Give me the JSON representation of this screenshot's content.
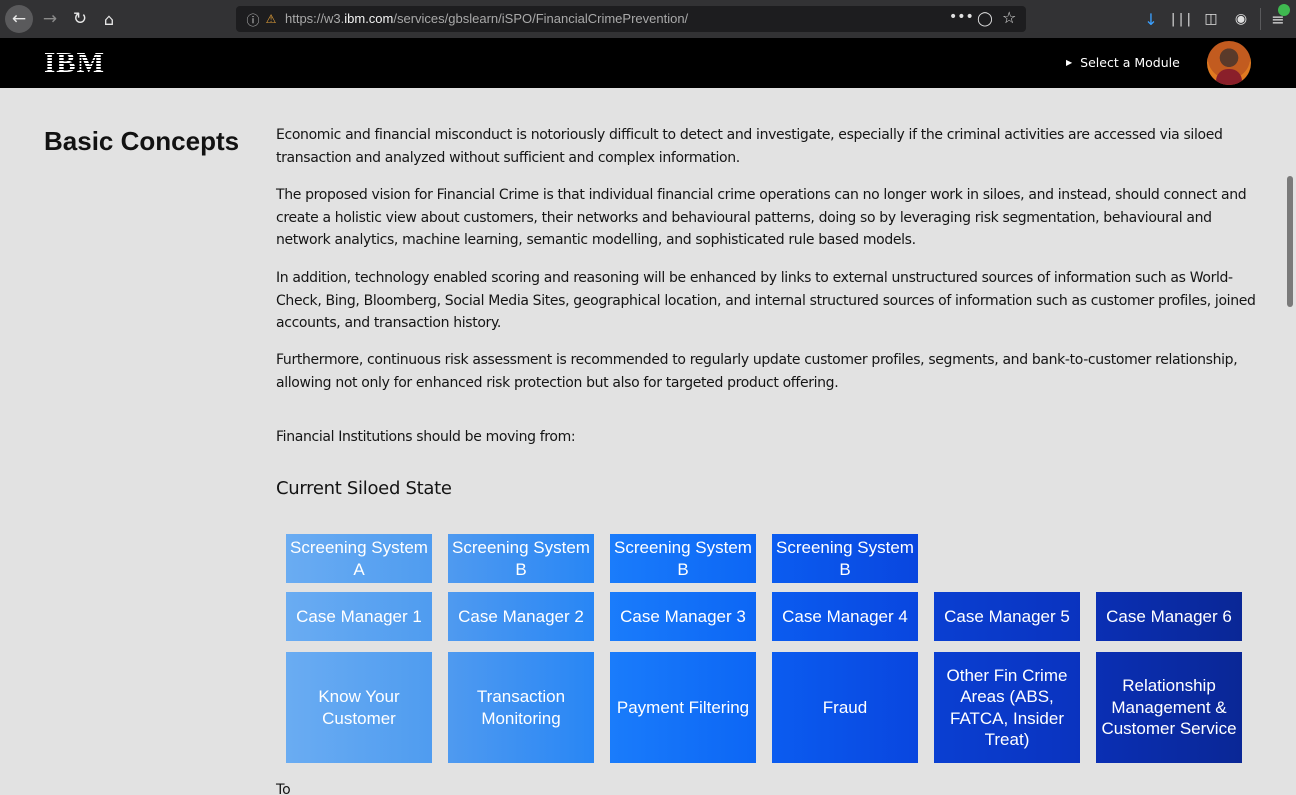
{
  "browser": {
    "url_prefix": "https://w3.",
    "url_domain": "ibm.com",
    "url_path": "/services/gbslearn/iSPO/FinancialCrimePrevention/",
    "icons": {
      "back": "arrow-left-icon",
      "forward": "arrow-right-icon",
      "reload": "reload-icon",
      "home": "home-icon",
      "info": "info-icon",
      "lock": "lock-warning-icon",
      "more": "more-icon",
      "pocket": "pocket-icon",
      "bookmark": "star-icon",
      "download": "download-icon",
      "library": "library-icon",
      "sidebar": "sidebar-icon",
      "account": "account-icon",
      "menu": "hamburger-menu-icon"
    }
  },
  "header": {
    "logo": "IBM",
    "module_link": "Select a Module"
  },
  "content": {
    "section_title": "Basic Concepts",
    "paragraphs": [
      "Economic and financial misconduct is notoriously difficult to detect and investigate, especially if the criminal activities are accessed via siloed transaction and analyzed without sufficient and complex information.",
      "The proposed vision for Financial Crime is that individual financial crime operations can no longer work in siloes, and instead, should connect and create a holistic view about customers, their networks and behavioural patterns, doing so by leveraging risk segmentation, behavioural and network analytics, machine learning, semantic modelling, and sophisticated rule based models.",
      "In addition, technology enabled scoring and reasoning will be enhanced by links to external unstructured sources of information such as World-Check, Bing, Bloomberg, Social Media Sites, geographical location, and internal structured sources of information such as customer profiles, joined accounts, and transaction history.",
      "Furthermore, continuous risk assessment is recommended to regularly update customer profiles, segments, and bank-to-customer relationship, allowing not only for enhanced risk protection but also for targeted product offering.",
      "Financial Institutions should be moving from:"
    ],
    "state_title": "Current Siloed State",
    "to_label": "To",
    "diagram": {
      "screening": [
        "Screening System A",
        "Screening System B",
        "Screening System B",
        "Screening System B"
      ],
      "case_managers": [
        "Case Manager 1",
        "Case Manager 2",
        "Case Manager 3",
        "Case Manager 4",
        "Case Manager 5",
        "Case Manager 6"
      ],
      "areas": [
        "Know Your Customer",
        "Transaction Monitoring",
        "Payment Filtering",
        "Fraud",
        "Other Fin Crime Areas (ABS, FATCA, Insider Treat)",
        "Relationship Management & Customer Service"
      ]
    }
  }
}
